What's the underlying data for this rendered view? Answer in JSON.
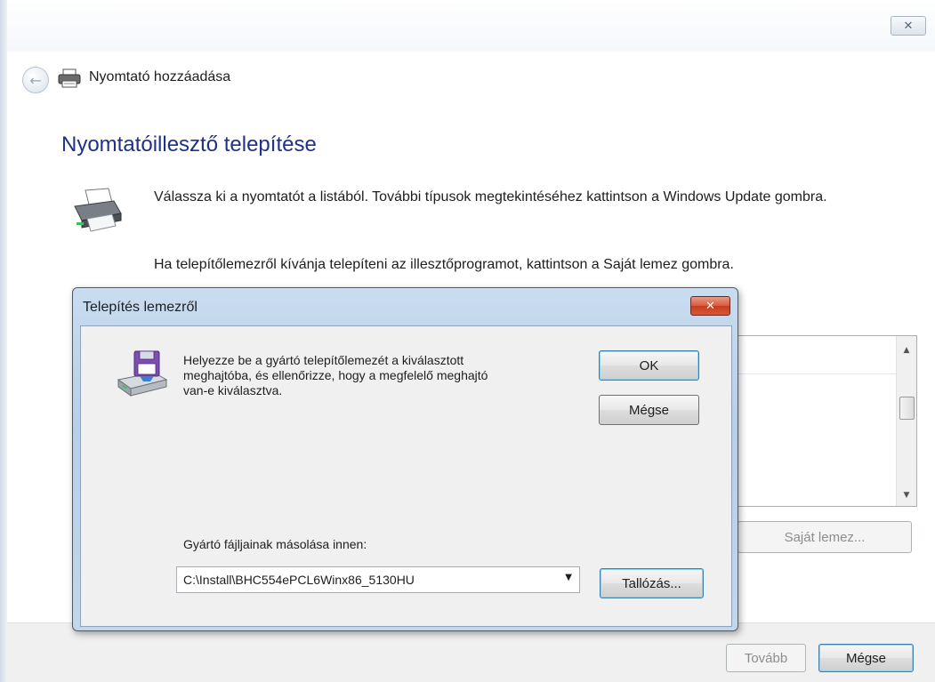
{
  "window": {
    "title": "Nyomtató hozzáadása",
    "close_symbol": "✕"
  },
  "nav": {
    "back_icon": "back-arrow-icon",
    "back_symbol": "←"
  },
  "main": {
    "heading": "Nyomtatóillesztő telepítése",
    "intro": "Válassza ki a nyomtatót a listából. További típusok megtekintéséhez kattintson a Windows Update gombra.",
    "disk_hint": "Ha telepítőlemezről kívánja telepíteni az illesztőprogramot, kattintson a Saját lemez gombra.",
    "own_disk_button": "Saját lemez...",
    "scroll_up_symbol": "▲",
    "scroll_down_symbol": "▼"
  },
  "footer": {
    "next_button": "Tovább",
    "cancel_button": "Mégse"
  },
  "dialog": {
    "title": "Telepítés lemezről",
    "close_symbol": "✕",
    "message": "Helyezze be a gyártó telepítőlemezét a kiválasztott meghajtóba, és ellenőrizze, hogy a megfelelő meghajtó van-e kiválasztva.",
    "ok_button": "OK",
    "cancel_button": "Mégse",
    "copy_label": "Gyártó fájljainak másolása innen:",
    "path_value": "C:\\Install\\BHC554ePCL6Winx86_5130HU",
    "dropdown_symbol": "▼",
    "browse_button": "Tallózás..."
  },
  "colors": {
    "heading": "#1e3287",
    "dialog_frame": "#c2d6ec",
    "close_red": "#c63d1c"
  }
}
